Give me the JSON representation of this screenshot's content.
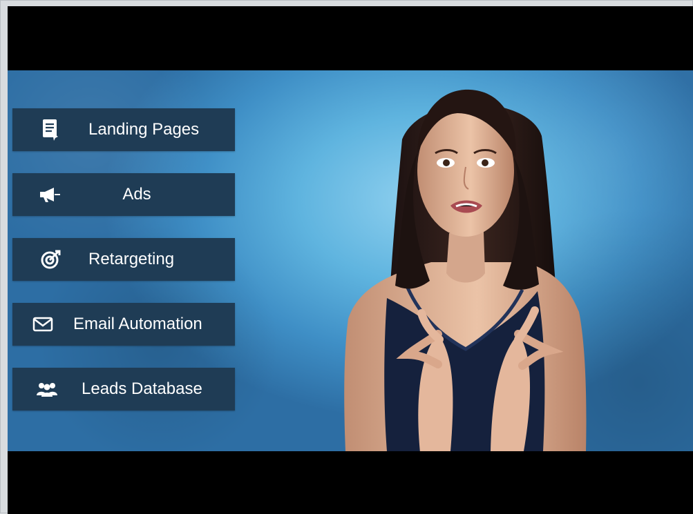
{
  "video": {
    "features": [
      {
        "label": "Landing Pages",
        "icon": "document-icon"
      },
      {
        "label": "Ads",
        "icon": "megaphone-icon"
      },
      {
        "label": "Retargeting",
        "icon": "target-icon"
      },
      {
        "label": "Email Automation",
        "icon": "email-icon"
      },
      {
        "label": "Leads Database",
        "icon": "people-icon"
      }
    ],
    "colors": {
      "panel": "#1f3c55",
      "background_blue": "#5fb4df",
      "letterbox": "#000000"
    }
  }
}
